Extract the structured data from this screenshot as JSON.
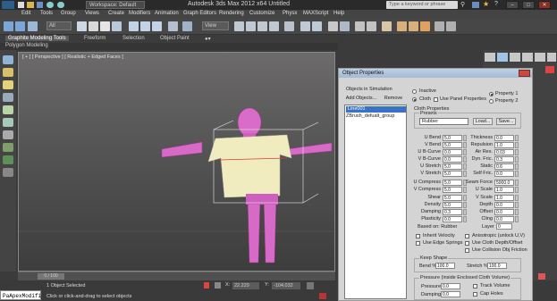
{
  "app": {
    "title": "Autodesk 3ds Max 2012 x64   Untitled",
    "workspace": "Workspace: Default",
    "help_search_placeholder": "Type a keyword or phrase"
  },
  "menubar": [
    "Edit",
    "Tools",
    "Group",
    "Views",
    "Create",
    "Modifiers",
    "Animation",
    "Graph Editors",
    "Rendering",
    "Customize",
    "Physx",
    "MAXScript",
    "Help"
  ],
  "toolbar": {
    "selection_filter": "All",
    "view_dropdown": "View"
  },
  "ribbon": {
    "tabs": [
      "Graphite Modeling Tools",
      "Freeform",
      "Selection",
      "Object Paint"
    ],
    "subtitle": "Polygon Modeling"
  },
  "viewport": {
    "label": "[ + ] [ Perspective ] [ Realistic + Edged Faces ]"
  },
  "timeline": {
    "frame": "0 / 100"
  },
  "status": {
    "selection": "1 Object Selected",
    "prompt": "Click or click-and-drag to select objects",
    "x_value": "22.229",
    "y_value": "-104.032",
    "maxscript": "PaApexModifi"
  },
  "dialog": {
    "title": "Object Properties",
    "objects_label": "Objects in Simulation",
    "add_objects": "Add Objects...",
    "remove": "Remove",
    "list_items": [
      "Line001",
      "ZBrush_defualt_group"
    ],
    "inactive": "Inactive",
    "cloth": "Cloth",
    "use_panel": "Use Panel Properties",
    "property1": "Property 1",
    "property2": "Property 2",
    "cloth_properties": "Cloth Properties",
    "presets": "Presets",
    "preset_value": "Rubber",
    "load": "Load...",
    "save": "Save...",
    "left_params": [
      {
        "label": "U Bend",
        "value": "5.0"
      },
      {
        "label": "V Bend",
        "value": "5.0"
      },
      {
        "label": "U B-Curve",
        "value": "0.0"
      },
      {
        "label": "V B-Curve",
        "value": "0.0"
      },
      {
        "label": "U Stretch",
        "value": "5.0"
      },
      {
        "label": "V Stretch",
        "value": "5.0"
      },
      {
        "label": "U Compress",
        "value": "5.0"
      },
      {
        "label": "V Compress",
        "value": "5.0"
      },
      {
        "label": "Shear",
        "value": "5.0"
      },
      {
        "label": "Density",
        "value": "5.0"
      },
      {
        "label": "Damping",
        "value": "0.3"
      },
      {
        "label": "Plasticity",
        "value": "0.0"
      }
    ],
    "right_params": [
      {
        "label": "Thickness",
        "value": "0.0"
      },
      {
        "label": "Repulsion",
        "value": "1.0"
      },
      {
        "label": "Air Res.",
        "value": "0.03"
      },
      {
        "label": "Dyn. Fric.",
        "value": "0.3"
      },
      {
        "label": "Static",
        "value": "0.6"
      },
      {
        "label": "Self Fric.",
        "value": "0.0"
      },
      {
        "label": "Seam Force",
        "value": "5000.0"
      },
      {
        "label": "U Scale",
        "value": "1.0"
      },
      {
        "label": "V Scale",
        "value": "1.0"
      },
      {
        "label": "Depth",
        "value": "0.0"
      },
      {
        "label": "Offset",
        "value": "0.0"
      },
      {
        "label": "Cling",
        "value": "0.0"
      }
    ],
    "based_on": "Based on: Rubber",
    "layer": "Layer",
    "layer_value": "0",
    "checks": [
      "Inherit Velocity",
      "Use Edge Springs",
      "Anisotropic (unlock U,V)",
      "Use Cloth Depth/Offset",
      "Use Collision Obj Friction"
    ],
    "keep_shape": "Keep Shape",
    "bend_pct_label": "Bend %",
    "bend_pct": "100.0",
    "stretch_pct_label": "Stretch %",
    "stretch_pct": "100.0",
    "pressure_group": "Pressure (inside Enclosed Cloth Volume)",
    "pressure_label": "Pressure",
    "pressure": "0.0",
    "damping_label": "Damping",
    "damping": "0.0",
    "track_volume": "Track Volume",
    "cap_holes": "Cap Holes"
  },
  "colors": {
    "accent_blue": "#3a72c8",
    "mesh_magenta": "#d050c0",
    "cloth_yellow": "#f0ecc0"
  }
}
